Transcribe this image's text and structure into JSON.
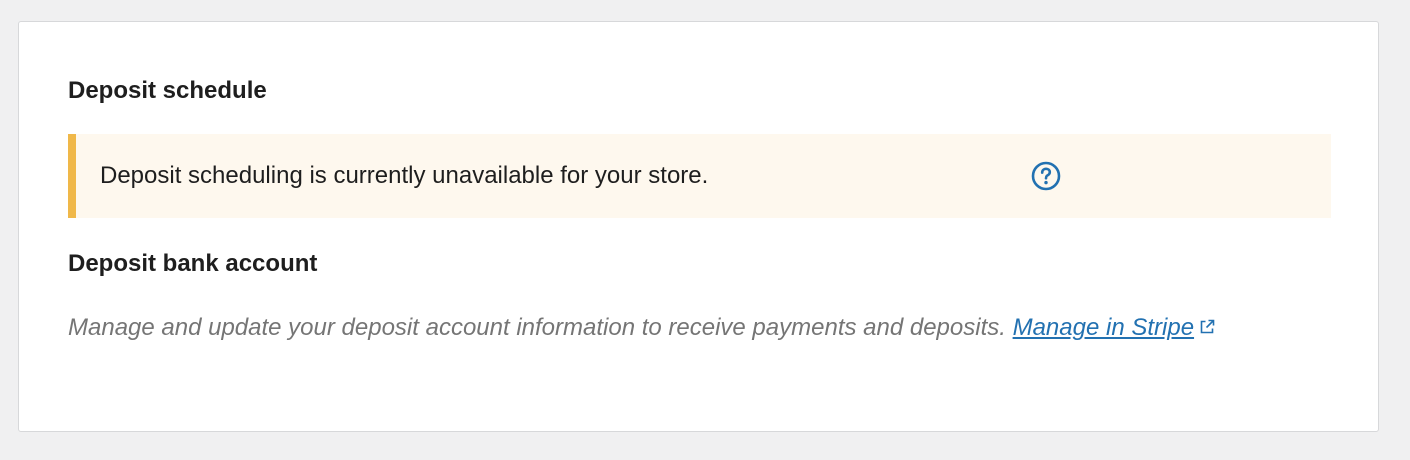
{
  "schedule_section": {
    "title": "Deposit schedule",
    "notice_text": "Deposit scheduling is currently unavailable for your store.",
    "help_icon": "help-circle-icon"
  },
  "bank_section": {
    "title": "Deposit bank account",
    "description": "Manage and update your deposit account information to receive payments and deposits.",
    "link_label": "Manage in Stripe",
    "link_icon": "external-link-icon"
  },
  "colors": {
    "notice_background": "#fef8ee",
    "notice_border": "#f0b849",
    "link": "#2271b1",
    "description_text": "#757575"
  }
}
